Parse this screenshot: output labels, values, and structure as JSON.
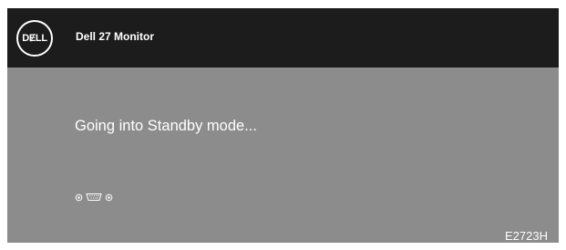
{
  "header": {
    "logo_text": "DɆLL",
    "model_name": "Dell 27 Monitor"
  },
  "main": {
    "message": "Going into Standby mode...",
    "input_icons": [
      "dp-port-icon",
      "vga-port-icon",
      "hdmi-port-icon"
    ]
  },
  "footer": {
    "model_code": "E2723H"
  },
  "colors": {
    "header_bg": "#1c1c1c",
    "body_bg": "#8b8c8b",
    "text": "#ffffff"
  }
}
